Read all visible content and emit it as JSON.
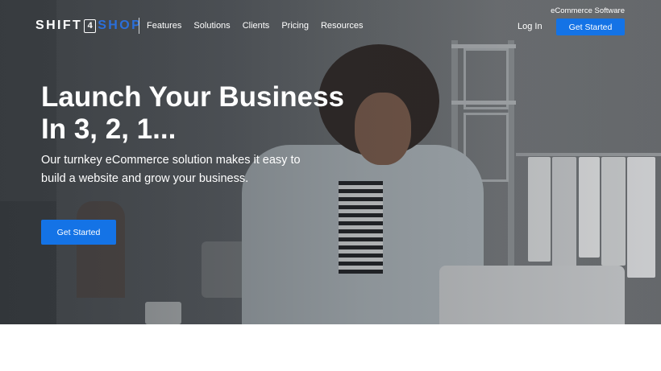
{
  "brand": {
    "logo_left": "SHIFT",
    "logo_number": "4",
    "logo_right": "SHOP",
    "accent_color": "#1473e6",
    "logo_accent_color": "#2a6fdb"
  },
  "header": {
    "tagline": "eCommerce Software",
    "menu": [
      {
        "label": "Features"
      },
      {
        "label": "Solutions"
      },
      {
        "label": "Clients"
      },
      {
        "label": "Pricing"
      },
      {
        "label": "Resources"
      }
    ],
    "login_label": "Log In",
    "cta_label": "Get Started"
  },
  "hero": {
    "headline_line1": "Launch Your Business",
    "headline_line2": "In 3, 2, 1...",
    "sub_line1": "Our turnkey eCommerce solution makes it easy to",
    "sub_line2": "build a website and grow your business.",
    "cta_label": "Get Started"
  }
}
